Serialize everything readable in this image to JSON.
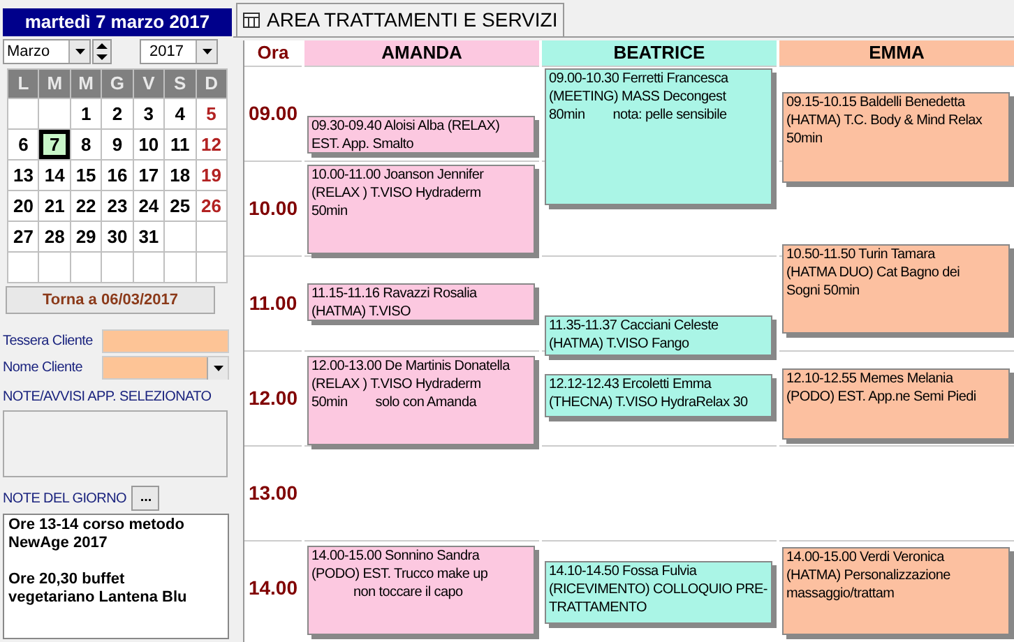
{
  "date_header": "martedì 7 marzo 2017",
  "month_select": {
    "value": "Marzo"
  },
  "year_select": {
    "value": "2017"
  },
  "calendar": {
    "weekdays": [
      "L",
      "M",
      "M",
      "G",
      "V",
      "S",
      "D"
    ],
    "days": [
      {
        "label": "1",
        "selected": false
      },
      {
        "label": "2",
        "selected": false
      },
      {
        "label": "3",
        "selected": false
      },
      {
        "label": "4",
        "selected": false
      },
      {
        "label": "5",
        "selected": false
      },
      {
        "label": "6",
        "selected": false
      },
      {
        "label": "7",
        "selected": true
      },
      {
        "label": "8",
        "selected": false
      },
      {
        "label": "9",
        "selected": false
      },
      {
        "label": "10",
        "selected": false
      },
      {
        "label": "11",
        "selected": false
      },
      {
        "label": "12",
        "selected": false
      },
      {
        "label": "13",
        "selected": false
      },
      {
        "label": "14",
        "selected": false
      },
      {
        "label": "15",
        "selected": false
      },
      {
        "label": "16",
        "selected": false
      },
      {
        "label": "17",
        "selected": false
      },
      {
        "label": "18",
        "selected": false
      },
      {
        "label": "19",
        "selected": false
      },
      {
        "label": "20",
        "selected": false
      },
      {
        "label": "21",
        "selected": false
      },
      {
        "label": "22",
        "selected": false
      },
      {
        "label": "23",
        "selected": false
      },
      {
        "label": "24",
        "selected": false
      },
      {
        "label": "25",
        "selected": false
      },
      {
        "label": "26",
        "selected": false
      },
      {
        "label": "27",
        "selected": false
      },
      {
        "label": "28",
        "selected": false
      },
      {
        "label": "29",
        "selected": false
      },
      {
        "label": "30",
        "selected": false
      },
      {
        "label": "31",
        "selected": false
      }
    ]
  },
  "today_button": "Torna a 06/03/2017",
  "client_fields": [
    {
      "label": "Tessera Cliente",
      "kind": "text"
    },
    {
      "label": "Nome Cliente",
      "kind": "dropdown"
    }
  ],
  "notes_label": "NOTE/AVVISI APP. SELEZIONATO",
  "day_notes": {
    "label": "NOTE DEL GIORNO",
    "button": "...",
    "paragraphs": [
      [
        "Ore 13-14 corso metodo",
        "NewAge 2017"
      ],
      [
        "Ore 20,30 buffet",
        "vegetariano Lantena Blu"
      ]
    ]
  },
  "tab": {
    "title": "AREA TRATTAMENTI E SERVIZI"
  },
  "hour_header": "Ora",
  "hours": [
    "09.00",
    "10.00",
    "11.00",
    "12.00",
    "13.00",
    "14.00"
  ],
  "staff": [
    {
      "name": "AMANDA",
      "color": "#fcc8e0",
      "appointments": [
        {
          "lines": [
            "09.30-09.40 Aloisi Alba (RELAX)",
            "EST. App. Smalto"
          ]
        },
        {
          "lines": [
            "10.00-11.00 Joanson Jennifer",
            "(RELAX ) T.VISO Hydraderm",
            "50min"
          ]
        },
        {
          "lines": [
            "11.15-11.16 Ravazzi Rosalia",
            "(HATMA) T.VISO"
          ]
        },
        {
          "lines": [
            "12.00-13.00 De Martinis Donatella",
            "(RELAX ) T.VISO Hydraderm",
            "50min"
          ],
          "note": "solo con Amanda"
        },
        {
          "lines": [
            "14.00-15.00 Sonnino Sandra",
            "(PODO) EST. Trucco make up"
          ],
          "note": "non toccare il capo"
        }
      ]
    },
    {
      "name": "BEATRICE",
      "color": "#aaf5e6",
      "appointments": [
        {
          "lines": [
            "09.00-10.30 Ferretti Francesca",
            "(MEETING) MASS Decongest",
            "80min"
          ],
          "note": "nota: pelle sensibile"
        },
        {
          "lines": [
            "11.35-11.37 Cacciani Celeste",
            "(HATMA) T.VISO Fango"
          ]
        },
        {
          "lines": [
            "12.12-12.43 Ercoletti Emma",
            "(THECNA) T.VISO HydraRelax 30"
          ]
        },
        {
          "lines": [
            "14.10-14.50 Fossa Fulvia",
            "(RICEVIMENTO) COLLOQUIO PRE-",
            "TRATTAMENTO"
          ]
        }
      ]
    },
    {
      "name": "EMMA",
      "color": "#fcc0a0",
      "appointments": [
        {
          "lines": [
            "09.15-10.15 Baldelli Benedetta",
            "(HATMA) T.C. Body & Mind Relax",
            "50min"
          ]
        },
        {
          "lines": [
            "10.50-11.50 Turin Tamara",
            "(HATMA DUO) Cat Bagno dei",
            "Sogni 50min"
          ]
        },
        {
          "lines": [
            "12.10-12.55 Memes Melania",
            "(PODO) EST. App.ne Semi Piedi"
          ]
        },
        {
          "lines": [
            "14.00-15.00 Verdi Veronica",
            "(HATMA) Personalizzazione",
            "massaggio/trattam"
          ]
        }
      ]
    }
  ]
}
